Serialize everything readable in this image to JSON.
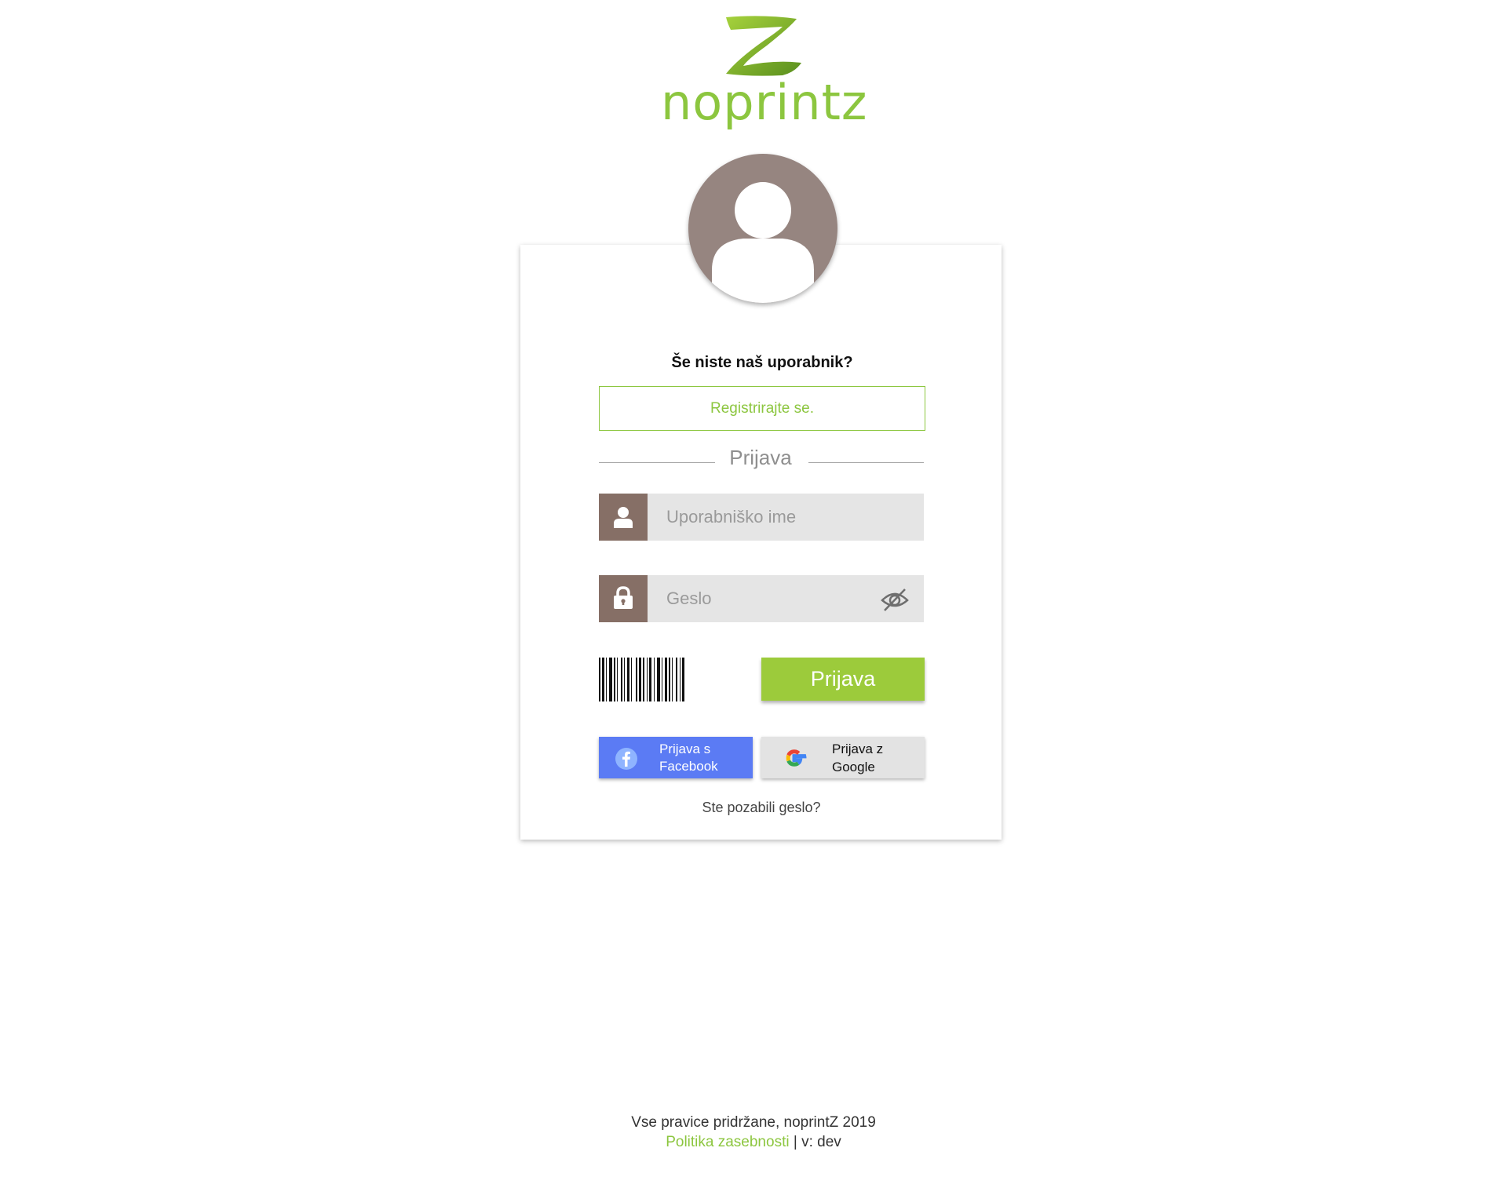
{
  "logo": {
    "text": "noprintz"
  },
  "signup": {
    "question": "Še niste naš uporabnik?",
    "register_label": "Registrirajte se."
  },
  "login": {
    "section_title": "Prijava",
    "username_placeholder": "Uporabniško ime",
    "password_placeholder": "Geslo",
    "submit_label": "Prijava",
    "facebook_label_line1": "Prijava s",
    "facebook_label_line2": "Facebook",
    "google_label_line1": "Prijava z",
    "google_label_line2": "Google",
    "forgot_label": "Ste pozabili geslo?"
  },
  "footer": {
    "copyright": "Vse pravice pridržane, noprintZ 2019",
    "privacy_link": "Politika zasebnosti",
    "separator": "|",
    "version": "v: dev"
  },
  "icons": [
    "user-icon",
    "lock-icon",
    "eye-off-icon",
    "facebook-icon",
    "google-icon",
    "barcode-icon"
  ],
  "colors": {
    "brand_green": "#8cc63f",
    "button_green": "#9ccb3b",
    "icon_brown": "#866f66",
    "avatar_gray": "#968580",
    "facebook_blue": "#5b7bf4",
    "google_gray": "#e3e3e3"
  }
}
